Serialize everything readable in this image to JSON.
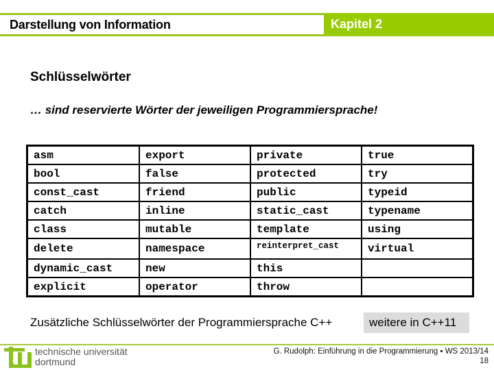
{
  "header": {
    "title": "Darstellung von Information",
    "chapter": "Kapitel 2",
    "accent_color": "#99cc00"
  },
  "section_title": "Schlüsselwörter",
  "subtitle": "… sind reservierte Wörter der jeweiligen Programmiersprache!",
  "keywords_table": {
    "rows": [
      [
        "asm",
        "export",
        "private",
        "true"
      ],
      [
        "bool",
        "false",
        "protected",
        "try"
      ],
      [
        "const_cast",
        "friend",
        "public",
        "typeid"
      ],
      [
        "catch",
        "inline",
        "static_cast",
        "typename"
      ],
      [
        "class",
        "mutable",
        "template",
        "using"
      ],
      [
        "delete",
        "namespace",
        "reinterpret_cast",
        "virtual"
      ],
      [
        "dynamic_cast",
        "new",
        "this",
        ""
      ],
      [
        "explicit",
        "operator",
        "throw",
        ""
      ]
    ]
  },
  "note": "Zusätzliche Schlüsselwörter der Programmiersprache C++",
  "more_box": "weitere in C++11",
  "footer": {
    "university_line1": "technische universität",
    "university_line2": "dortmund",
    "credit": "G. Rudolph: Einführung in die Programmierung ▪ WS 2013/14",
    "page_number": "18"
  }
}
